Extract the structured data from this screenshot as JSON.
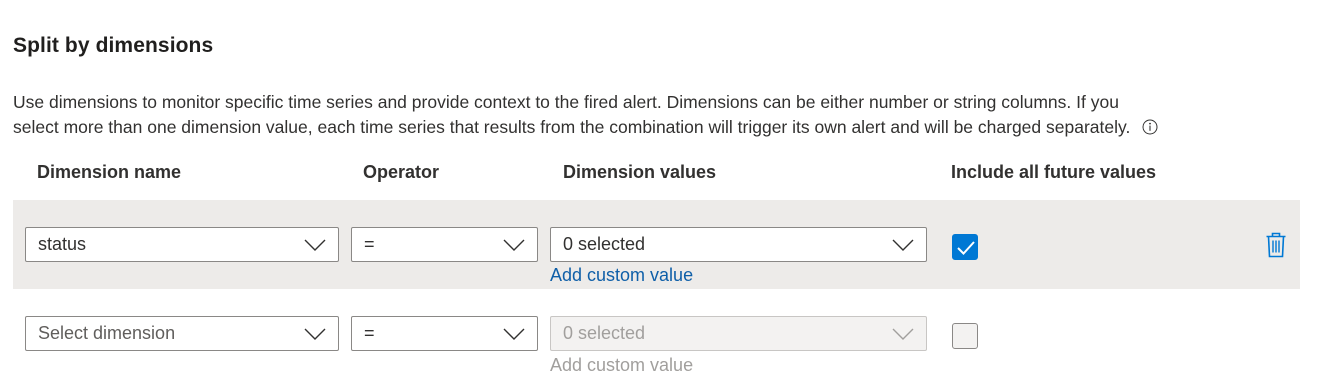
{
  "section": {
    "title": "Split by dimensions",
    "description_line1": "Use dimensions to monitor specific time series and provide context to the fired alert. Dimensions can be either number or string columns. If you",
    "description_line2": "select more than one dimension value, each time series that results from the combination will trigger its own alert and will be charged separately.",
    "info_icon": "info-icon"
  },
  "columns": {
    "dimension_name": "Dimension name",
    "operator": "Operator",
    "dimension_values": "Dimension values",
    "include_future": "Include all future values"
  },
  "rows": [
    {
      "dimension": "status",
      "operator": "=",
      "values": "0 selected",
      "add_custom": "Add custom value",
      "include_future": true,
      "highlighted": true,
      "delete_icon": "trash-icon"
    },
    {
      "dimension": "Select dimension",
      "operator": "=",
      "values": "0 selected",
      "add_custom": "Add custom value",
      "include_future": false,
      "values_disabled": true
    }
  ],
  "colors": {
    "accent": "#0078d4",
    "link": "#0f5fa8",
    "row_highlight": "#edebe9"
  }
}
